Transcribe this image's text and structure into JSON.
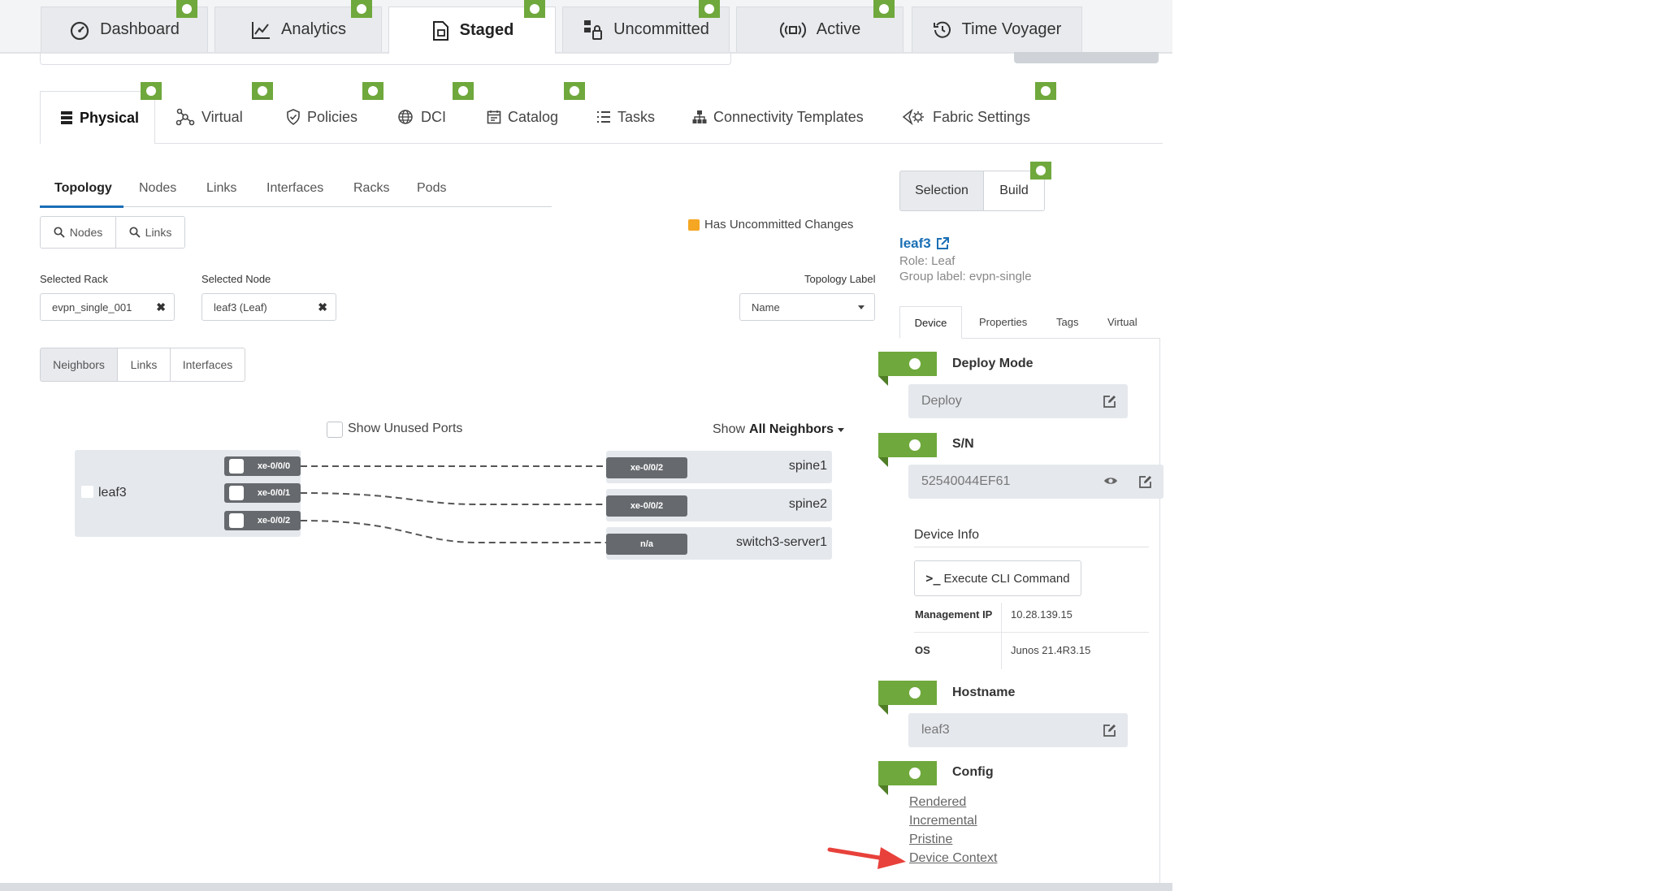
{
  "top_tabs": [
    {
      "label": "Dashboard",
      "icon": "dashboard-icon"
    },
    {
      "label": "Analytics",
      "icon": "analytics-icon"
    },
    {
      "label": "Staged",
      "icon": "staged-icon",
      "active": true
    },
    {
      "label": "Uncommitted",
      "icon": "uncommitted-icon"
    },
    {
      "label": "Active",
      "icon": "active-icon"
    },
    {
      "label": "Time Voyager",
      "icon": "history-icon"
    }
  ],
  "nav_tabs": [
    {
      "label": "Physical",
      "active": true
    },
    {
      "label": "Virtual"
    },
    {
      "label": "Policies"
    },
    {
      "label": "DCI"
    },
    {
      "label": "Catalog"
    },
    {
      "label": "Tasks"
    },
    {
      "label": "Connectivity Templates"
    },
    {
      "label": "Fabric Settings"
    }
  ],
  "sub_tabs": [
    "Topology",
    "Nodes",
    "Links",
    "Interfaces",
    "Racks",
    "Pods"
  ],
  "search_buttons": {
    "nodes": "Nodes",
    "links": "Links"
  },
  "legend": {
    "uncommitted": "Has Uncommitted Changes",
    "color": "#f5a623"
  },
  "filters": {
    "rack_label": "Selected Rack",
    "rack_value": "evpn_single_001",
    "node_label": "Selected Node",
    "node_value": "leaf3 (Leaf)",
    "topo_label": "Topology Label",
    "topo_value": "Name"
  },
  "view_toggle": [
    "Neighbors",
    "Links",
    "Interfaces"
  ],
  "show_unused": "Show Unused Ports",
  "show_neighbors": {
    "prefix": "Show",
    "value": "All Neighbors"
  },
  "node": {
    "name": "leaf3",
    "ports": [
      "xe-0/0/0",
      "xe-0/0/1",
      "xe-0/0/2"
    ]
  },
  "neighbors": [
    {
      "port": "xe-0/0/2",
      "name": "spine1"
    },
    {
      "port": "xe-0/0/2",
      "name": "spine2"
    },
    {
      "port": "n/a",
      "name": "switch3-server1"
    }
  ],
  "right_panel": {
    "tabs": [
      "Selection",
      "Build"
    ],
    "title": "leaf3",
    "role": "Role: Leaf",
    "group": "Group label: evpn-single",
    "detail_tabs": [
      "Device",
      "Properties",
      "Tags",
      "Virtual"
    ],
    "deploy_mode_title": "Deploy Mode",
    "deploy_mode_value": "Deploy",
    "sn_title": "S/N",
    "sn_value": "52540044EF61",
    "device_info_title": "Device Info",
    "execute_cli": "Execute CLI Command",
    "mgmt_ip_label": "Management IP",
    "mgmt_ip_value": "10.28.139.15",
    "os_label": "OS",
    "os_value": "Junos 21.4R3.15",
    "hostname_title": "Hostname",
    "hostname_value": "leaf3",
    "config_title": "Config",
    "config_links": [
      "Rendered",
      "Incremental",
      "Pristine",
      "Device Context"
    ]
  },
  "colors": {
    "accent_green": "#6fa83c",
    "link_blue": "#1a6fb5",
    "arrow_red": "#e8413b"
  }
}
